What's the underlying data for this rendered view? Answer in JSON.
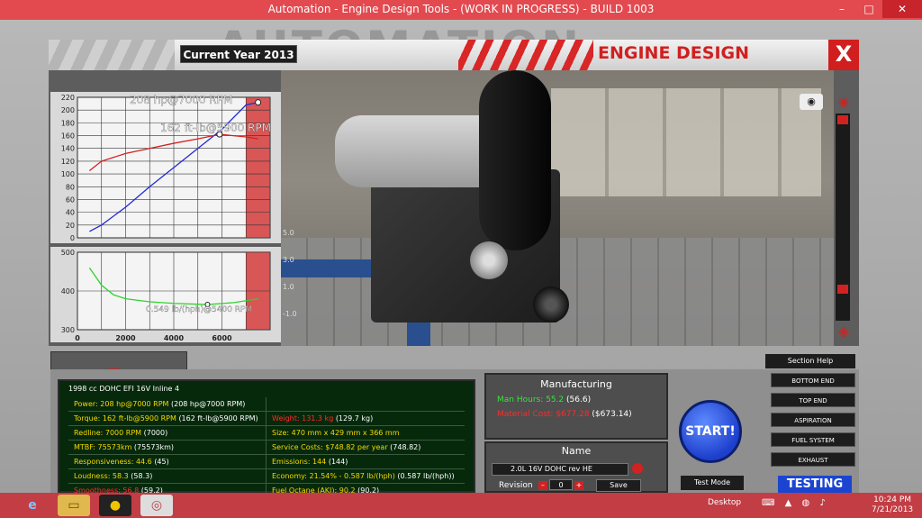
{
  "window": {
    "title": "Automation - Engine Design Tools - (WORK IN PROGRESS) - BUILD 1003",
    "controls": [
      "–",
      "□",
      "✕"
    ]
  },
  "brand_text": "AUTOMATION",
  "header": {
    "current_year": "Current Year 2013",
    "section_title": "ENGINE DESIGN",
    "close": "X"
  },
  "chart_data": [
    {
      "type": "line",
      "yticks": [
        0,
        20,
        40,
        60,
        80,
        100,
        120,
        140,
        160,
        180,
        200,
        220
      ],
      "ylim": [
        0,
        220
      ],
      "xlim": [
        0,
        8000
      ],
      "annotations": [
        "208 hp@7000 RPM",
        "162 ft-lb@5900 RPM"
      ],
      "series": [
        {
          "color": "#1f2bd6",
          "x": [
            500,
            1000,
            2000,
            3000,
            4000,
            5000,
            6000,
            7000,
            7500
          ],
          "y": [
            10,
            20,
            48,
            80,
            110,
            140,
            170,
            208,
            212
          ]
        },
        {
          "color": "#d61f1f",
          "x": [
            500,
            1000,
            2000,
            3000,
            4000,
            5000,
            5900,
            7000,
            7500
          ],
          "y": [
            105,
            120,
            132,
            140,
            148,
            155,
            162,
            158,
            155
          ]
        }
      ],
      "redline_from": 7000
    },
    {
      "type": "line",
      "yticks": [
        300,
        400,
        500
      ],
      "ylim": [
        300,
        500
      ],
      "xticks": [
        "0",
        "2000",
        "4000",
        "6000"
      ],
      "xlim": [
        0,
        8000
      ],
      "right_ticks": [
        "5.0",
        "3.0",
        "1.0",
        "-1.0"
      ],
      "annotations": [
        "0.549 lb/(hph)@5400 RPM"
      ],
      "series": [
        {
          "color": "#2ed32e",
          "x": [
            500,
            1000,
            1500,
            2000,
            3000,
            4000,
            5400,
            6500,
            7500
          ],
          "y": [
            460,
            415,
            390,
            380,
            372,
            368,
            365,
            370,
            380
          ]
        }
      ],
      "redline_from": 7000
    }
  ],
  "stats": {
    "title": "1998 cc DOHC EFI 16V Inline 4",
    "rows": [
      {
        "left_label": "Power: 208 hp@7000 RPM",
        "left_value": "(208 hp@7000 RPM)",
        "left_color": "y",
        "right_label": "",
        "right_value": "",
        "right_color": "y"
      },
      {
        "left_label": "Torque: 162 ft-lb@5900 RPM",
        "left_value": "(162 ft-lb@5900 RPM)",
        "left_color": "y",
        "right_label": "Weight: 131.3 kg",
        "right_value": "(129.7 kg)",
        "right_color": "r"
      },
      {
        "left_label": "Redline: 7000 RPM",
        "left_value": "(7000)",
        "left_color": "y",
        "right_label": "Size: 470 mm x 429 mm x 366 mm",
        "right_value": "",
        "right_color": "y"
      },
      {
        "left_label": "MTBF: 75573km",
        "left_value": "(75573km)",
        "left_color": "y",
        "right_label": "Service Costs: $748.82 per year",
        "right_value": "(748.82)",
        "right_color": "y"
      },
      {
        "left_label": "Responsiveness: 44.6",
        "left_value": "(45)",
        "left_color": "y",
        "right_label": "Emissions: 144",
        "right_value": "(144)",
        "right_color": "y"
      },
      {
        "left_label": "Loudness: 58.3",
        "left_value": "(58.3)",
        "left_color": "y",
        "right_label": "Economy: 21.54% - 0.587 lb/(hph)",
        "right_value": "(0.587 lb/(hph))",
        "right_color": "y"
      },
      {
        "left_label": "Smoothness: 56.8",
        "left_value": "(59.2)",
        "left_color": "r",
        "right_label": "Fuel Octane (AKI): 90.2",
        "right_value": "(90.2)",
        "right_color": "y"
      }
    ]
  },
  "manufacturing": {
    "title": "Manufacturing",
    "man_hours_label": "Man Hours: 55.2",
    "man_hours_value": "(56.6)",
    "material_label": "Material Cost: $677.28",
    "material_value": "($673.14)"
  },
  "name_panel": {
    "title": "Name",
    "value": "2.0L 16V DOHC rev HE",
    "revision_label": "Revision",
    "revision_value": "0",
    "save_label": "Save"
  },
  "start_label": "START!",
  "test_mode_label": "Test Mode",
  "section_help_label": "Section Help",
  "sections": [
    "BOTTOM END",
    "TOP END",
    "ASPIRATION",
    "FUEL SYSTEM",
    "EXHAUST"
  ],
  "testing_label": "TESTING",
  "taskbar": {
    "desktop_label": "Desktop",
    "time": "10:24 PM",
    "date": "7/21/2013"
  }
}
